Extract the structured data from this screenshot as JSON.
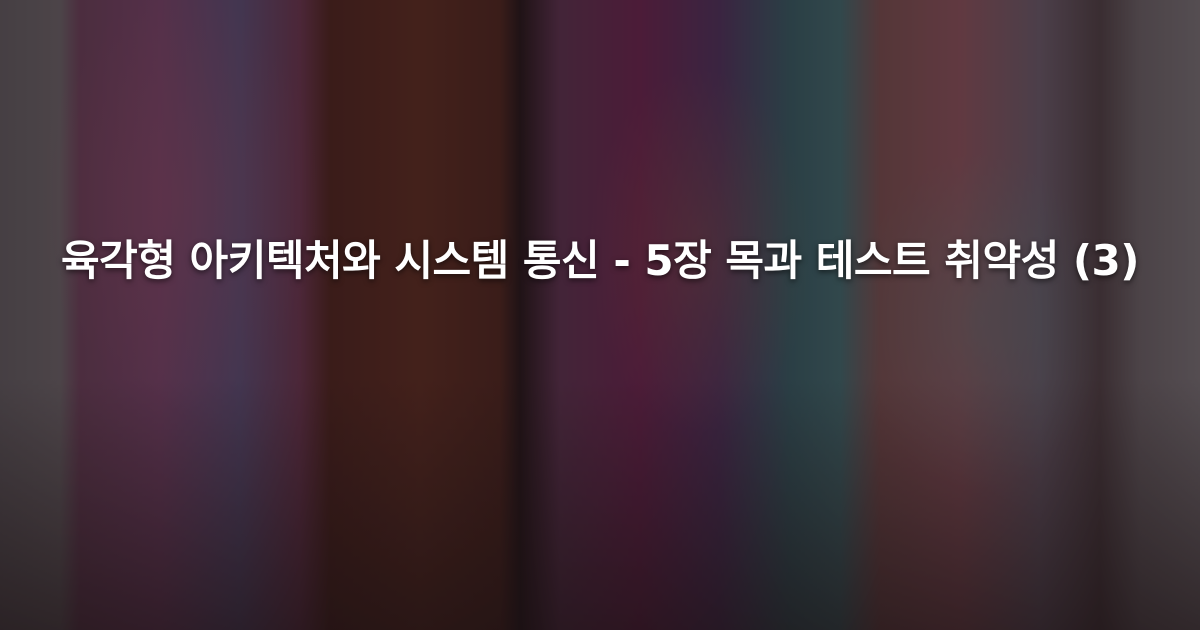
{
  "title": "육각형 아키텍처와 시스템 통신 - 5장 목과 테스트 취약성 (3)",
  "background": {
    "description_colors": [
      "#7a4a66",
      "#6b3426",
      "#3e6a72",
      "#a0606a"
    ],
    "overlay_color": "#140c10"
  }
}
